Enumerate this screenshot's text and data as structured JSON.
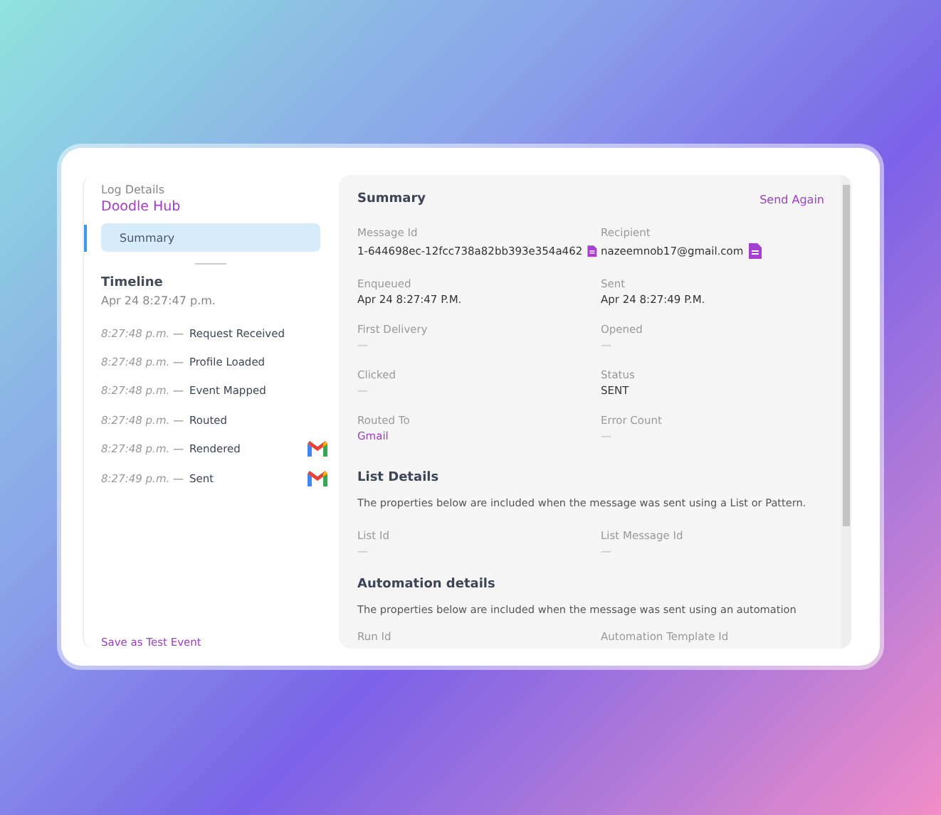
{
  "sidebar": {
    "eyebrow": "Log Details",
    "title": "Doodle Hub",
    "nav": [
      {
        "label": "Summary",
        "selected": true
      }
    ],
    "timeline": {
      "title": "Timeline",
      "start": "Apr 24 8:27:47 p.m.",
      "events": [
        {
          "time": "8:27:48 p.m.",
          "separator": "—",
          "label": "Request Received",
          "channel_icon": false
        },
        {
          "time": "8:27:48 p.m.",
          "separator": "—",
          "label": "Profile Loaded",
          "channel_icon": false
        },
        {
          "time": "8:27:48 p.m.",
          "separator": "—",
          "label": "Event Mapped",
          "channel_icon": false
        },
        {
          "time": "8:27:48 p.m.",
          "separator": "—",
          "label": "Routed",
          "channel_icon": false
        },
        {
          "time": "8:27:48 p.m.",
          "separator": "—",
          "label": "Rendered",
          "channel_icon": true
        },
        {
          "time": "8:27:49 p.m.",
          "separator": "—",
          "label": "Sent",
          "channel_icon": true
        }
      ]
    },
    "footer_link": "Save as Test Event"
  },
  "summary": {
    "title": "Summary",
    "action": "Send Again",
    "fields": [
      {
        "label": "Message Id",
        "value": "1-644698ec-12fcc738a82bb393e354a462",
        "kind": "copy"
      },
      {
        "label": "Recipient",
        "value": "nazeemnob17@gmail.com",
        "kind": "copy"
      },
      {
        "label": "Enqueued",
        "value": "Apr 24 8:27:47 P.M.",
        "kind": "strong"
      },
      {
        "label": "Sent",
        "value": "Apr 24 8:27:49 P.M.",
        "kind": "strong"
      },
      {
        "label": "First Delivery",
        "value": "—",
        "kind": "empty"
      },
      {
        "label": "Opened",
        "value": "—",
        "kind": "empty"
      },
      {
        "label": "Clicked",
        "value": "—",
        "kind": "empty"
      },
      {
        "label": "Status",
        "value": "SENT",
        "kind": "strong"
      },
      {
        "label": "Routed To",
        "value": "Gmail",
        "kind": "link"
      },
      {
        "label": "Error Count",
        "value": "—",
        "kind": "empty"
      }
    ]
  },
  "list_details": {
    "title": "List Details",
    "description": "The properties below are included when the message was sent using a List or Pattern.",
    "fields": [
      {
        "label": "List Id",
        "value": "—",
        "kind": "empty"
      },
      {
        "label": "List Message Id",
        "value": "—",
        "kind": "empty"
      }
    ]
  },
  "automation_details": {
    "title": "Automation details",
    "description": "The properties below are included when the message was sent using an automation",
    "fields": [
      {
        "label": "Run Id"
      },
      {
        "label": "Automation Template Id"
      }
    ]
  }
}
